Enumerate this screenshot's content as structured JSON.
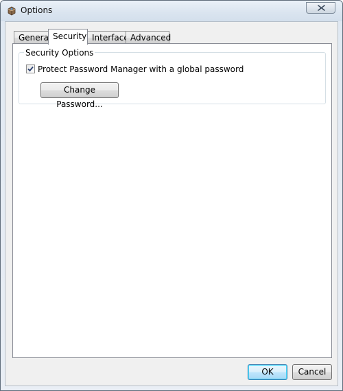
{
  "window": {
    "title": "Options",
    "icon": "options-gear-icon",
    "close_glyph": "X"
  },
  "tabs": [
    {
      "label": "General",
      "active": false
    },
    {
      "label": "Security",
      "active": true
    },
    {
      "label": "Interface",
      "active": false
    },
    {
      "label": "Advanced",
      "active": false
    }
  ],
  "security": {
    "group_label": "Security Options",
    "protect_checkbox": {
      "label": "Protect Password Manager with a global password",
      "checked": true
    },
    "change_password_label": "Change Password..."
  },
  "footer": {
    "ok_label": "OK",
    "cancel_label": "Cancel"
  },
  "colors": {
    "accent_button_border": "#3c7fb1",
    "panel_background": "#ffffff",
    "dialog_background": "#f0f0f0"
  }
}
